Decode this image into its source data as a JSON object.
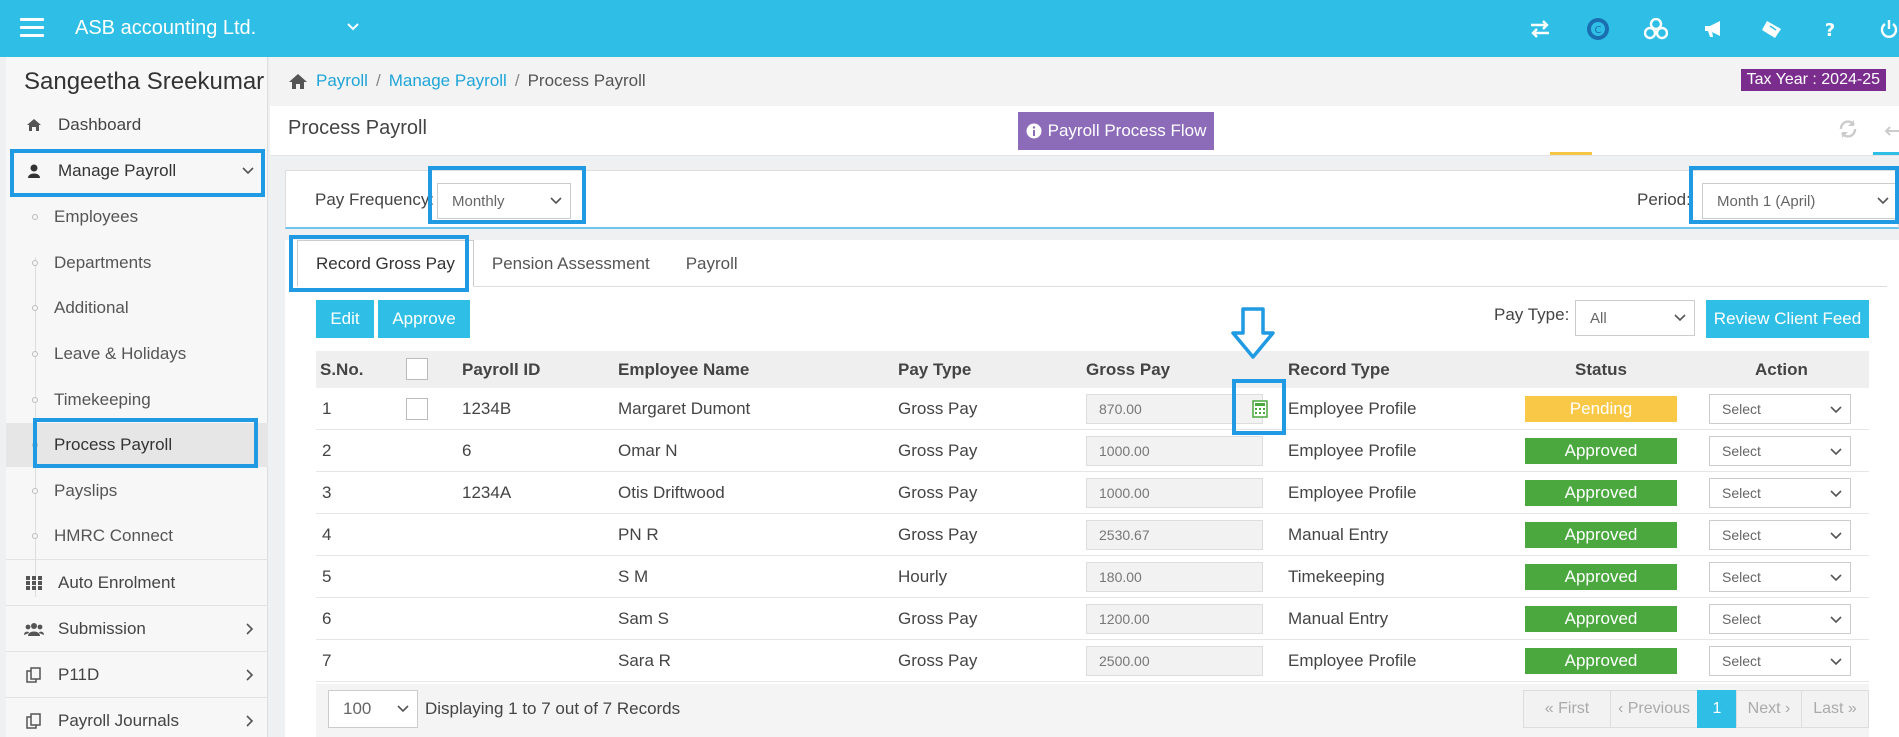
{
  "topbar": {
    "company": "ASB accounting Ltd.",
    "icons": [
      "swap-icon",
      "currency-icon",
      "biohazard-icon",
      "megaphone-icon",
      "ticket-icon",
      "help-icon",
      "power-icon"
    ]
  },
  "sidebar": {
    "user_name": "Sangeetha Sreekumar",
    "dashboard": "Dashboard",
    "manage_payroll": "Manage Payroll",
    "sub_items": [
      "Employees",
      "Departments",
      "Additional",
      "Leave & Holidays",
      "Timekeeping",
      "Process Payroll",
      "Payslips",
      "HMRC Connect"
    ],
    "auto_enrolment": "Auto Enrolment",
    "submission": "Submission",
    "p11d": "P11D",
    "payroll_journals": "Payroll Journals"
  },
  "breadcrumb": {
    "home": "Payroll",
    "parent": "Manage Payroll",
    "current": "Process Payroll"
  },
  "tax_year": "Tax Year : 2024-25",
  "page": {
    "title": "Process Payroll",
    "flow_button": "Payroll Process Flow"
  },
  "filters": {
    "pay_frequency_label": "Pay Frequency:",
    "pay_frequency_value": "Monthly",
    "period_label": "Period:",
    "period_value": "Month 1 (April)"
  },
  "tabs": [
    "Record Gross Pay",
    "Pension Assessment",
    "Payroll"
  ],
  "actions": {
    "edit": "Edit",
    "approve": "Approve",
    "pay_type_label": "Pay Type:",
    "pay_type_value": "All",
    "review_client_feed": "Review Client Feed"
  },
  "table": {
    "headers": [
      "S.No.",
      "Payroll ID",
      "Employee Name",
      "Pay Type",
      "Gross Pay",
      "Record Type",
      "Status",
      "Action"
    ],
    "action_placeholder": "Select",
    "rows": [
      {
        "sno": "1",
        "payroll_id": "1234B",
        "name": "Margaret Dumont",
        "pay_type": "Gross Pay",
        "gross": "870.00",
        "record_type": "Employee Profile",
        "status": "Pending"
      },
      {
        "sno": "2",
        "payroll_id": "6",
        "name": "Omar N",
        "pay_type": "Gross Pay",
        "gross": "1000.00",
        "record_type": "Employee Profile",
        "status": "Approved"
      },
      {
        "sno": "3",
        "payroll_id": "1234A",
        "name": "Otis Driftwood",
        "pay_type": "Gross Pay",
        "gross": "1000.00",
        "record_type": "Employee Profile",
        "status": "Approved"
      },
      {
        "sno": "4",
        "payroll_id": "",
        "name": "PN R",
        "pay_type": "Gross Pay",
        "gross": "2530.67",
        "record_type": "Manual Entry",
        "status": "Approved"
      },
      {
        "sno": "5",
        "payroll_id": "",
        "name": "S M",
        "pay_type": "Hourly",
        "gross": "180.00",
        "record_type": "Timekeeping",
        "status": "Approved"
      },
      {
        "sno": "6",
        "payroll_id": "",
        "name": "Sam S",
        "pay_type": "Gross Pay",
        "gross": "1200.00",
        "record_type": "Manual Entry",
        "status": "Approved"
      },
      {
        "sno": "7",
        "payroll_id": "",
        "name": "Sara R",
        "pay_type": "Gross Pay",
        "gross": "2500.00",
        "record_type": "Employee Profile",
        "status": "Approved"
      }
    ]
  },
  "footer": {
    "page_size": "100",
    "records_text": "Displaying 1 to 7 out of 7 Records",
    "pager": {
      "first": "« First",
      "previous": "‹ Previous",
      "current": "1",
      "next": "Next ›",
      "last": "Last »"
    }
  },
  "colors": {
    "primary": "#2fbfe6",
    "pending": "#f9c846",
    "approved": "#4aa83e",
    "tax_badge": "#7b2d8e",
    "flow_button": "#8c6bb8",
    "highlight": "#1f9ae3"
  }
}
